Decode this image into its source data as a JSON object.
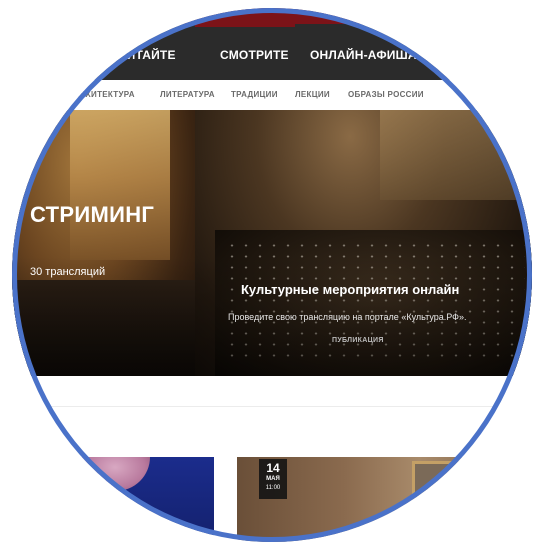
{
  "main_nav": {
    "items": [
      {
        "label": "ЧИТАЙТЕ"
      },
      {
        "label": "СМОТРИТЕ"
      },
      {
        "label": "ОНЛАЙН-АФИША"
      }
    ]
  },
  "sub_nav": {
    "items": [
      {
        "label": "АРХИТЕКТУРА"
      },
      {
        "label": "ЛИТЕРАТУРА"
      },
      {
        "label": "ТРАДИЦИИ"
      },
      {
        "label": "ЛЕКЦИИ"
      },
      {
        "label": "ОБРАЗЫ РОССИИ"
      }
    ]
  },
  "hero": {
    "title": "СТРИМИНГ",
    "subtitle": "30 трансляций"
  },
  "promo": {
    "title": "Культурные мероприятия онлайн",
    "description": "Проведите свою трансляцию на портале «Культура.РФ».",
    "tag": "ПУБЛИКАЦИЯ"
  },
  "event_card": {
    "date_day": "14",
    "date_month": "МАЯ",
    "time": "11:00"
  },
  "colors": {
    "brand_red": "#7c1318",
    "nav_dark": "#2b2b2b",
    "ring_blue": "#4a72c9"
  }
}
